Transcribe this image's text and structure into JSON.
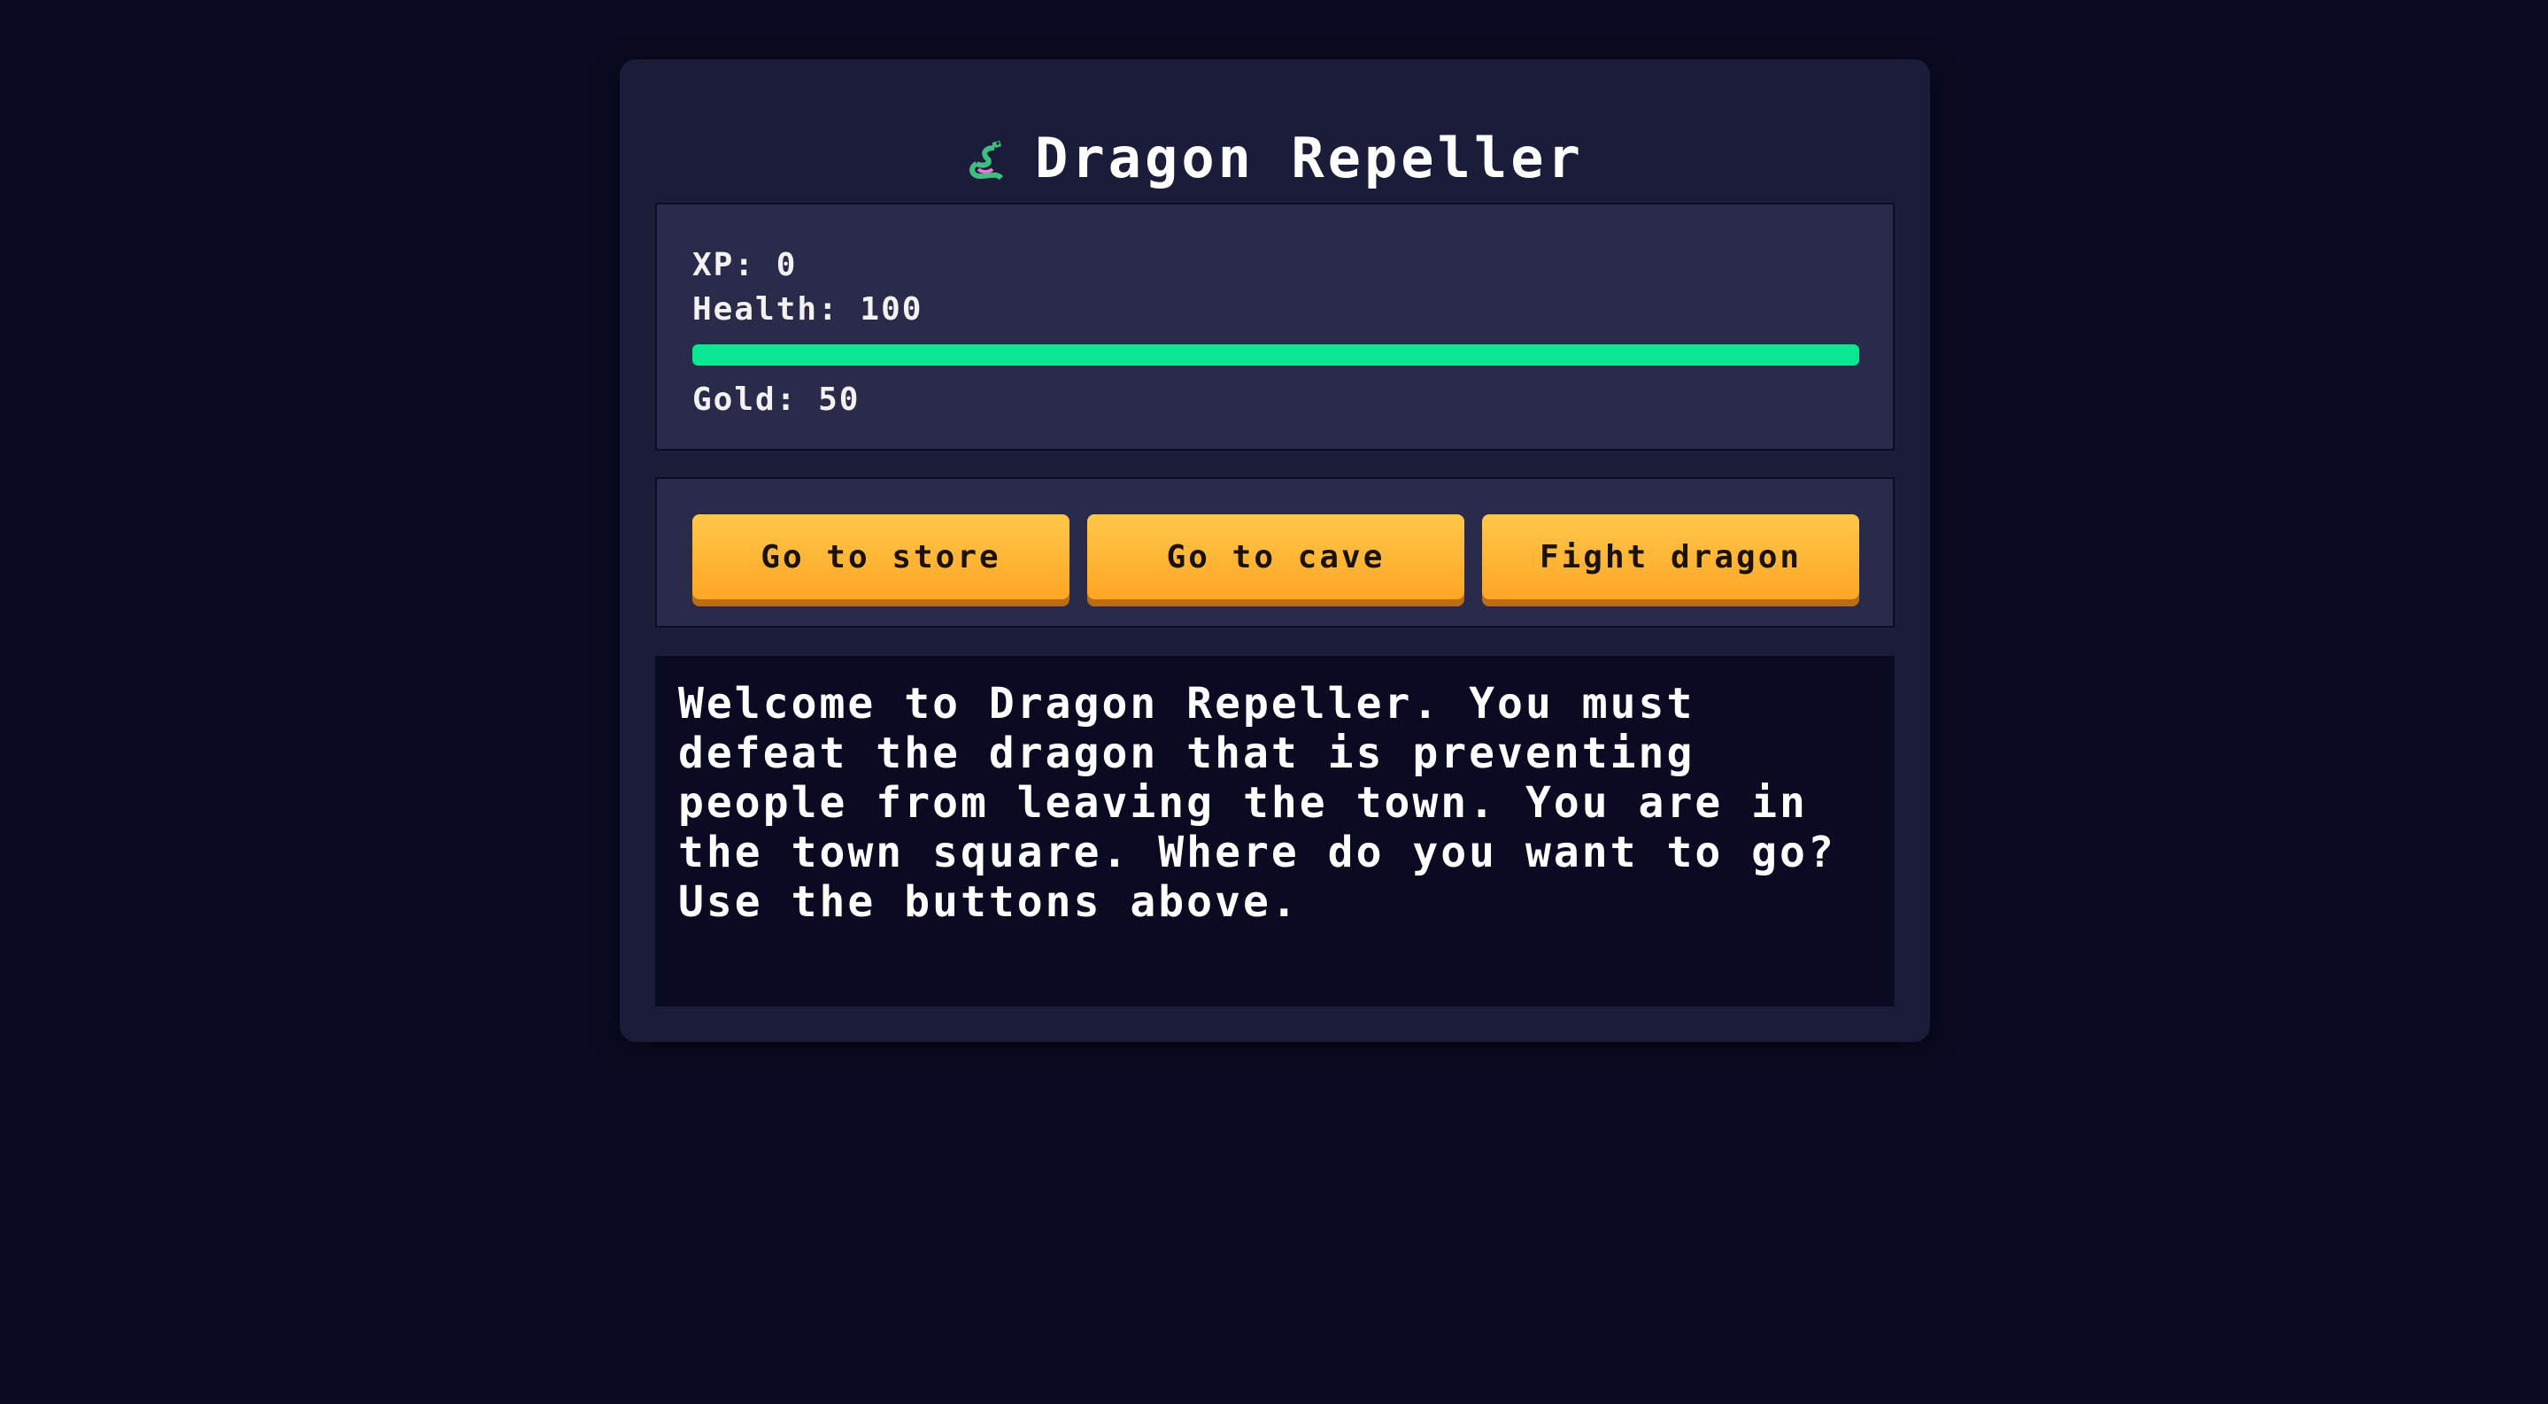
{
  "game": {
    "title": "Dragon Repeller",
    "title_icon": "dragon-icon"
  },
  "stats": {
    "xp_label": "XP:",
    "xp_value": "0",
    "health_label": "Health:",
    "health_value": "100",
    "health_fraction": 1.0,
    "gold_label": "Gold:",
    "gold_value": "50"
  },
  "controls": {
    "button1": "Go to store",
    "button2": "Go to cave",
    "button3": "Fight dragon"
  },
  "text": "Welcome to Dragon Repeller. You must defeat the dragon that is preventing people from leaving the town. You are in the town square. Where do you want to go? Use the buttons above.",
  "colors": {
    "background": "#0a0b22",
    "panel": "#1b1c3a",
    "health": "#08e892",
    "button": "#ffb234"
  }
}
